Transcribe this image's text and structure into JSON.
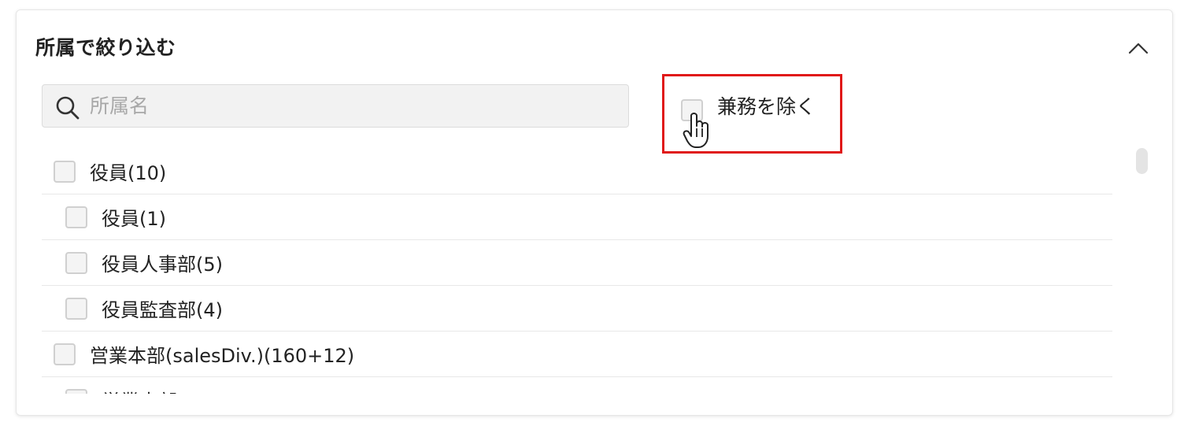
{
  "panel": {
    "title": "所属で絞り込む",
    "collapse_icon": "chevron-up-icon"
  },
  "search": {
    "placeholder": "所属名",
    "value": "",
    "icon": "search-icon"
  },
  "exclude_option": {
    "label": "兼務を除く",
    "checked": false,
    "highlight_color": "#e01818"
  },
  "tree": {
    "items": [
      {
        "label": "役員(10)",
        "level": 0,
        "checked": false
      },
      {
        "label": "役員(1)",
        "level": 1,
        "checked": false
      },
      {
        "label": "役員人事部(5)",
        "level": 1,
        "checked": false
      },
      {
        "label": "役員監査部(4)",
        "level": 1,
        "checked": false
      },
      {
        "label": "営業本部(salesDiv.)(160+12)",
        "level": 0,
        "checked": false
      },
      {
        "label": "営業本部",
        "level": 1,
        "checked": false
      }
    ]
  }
}
